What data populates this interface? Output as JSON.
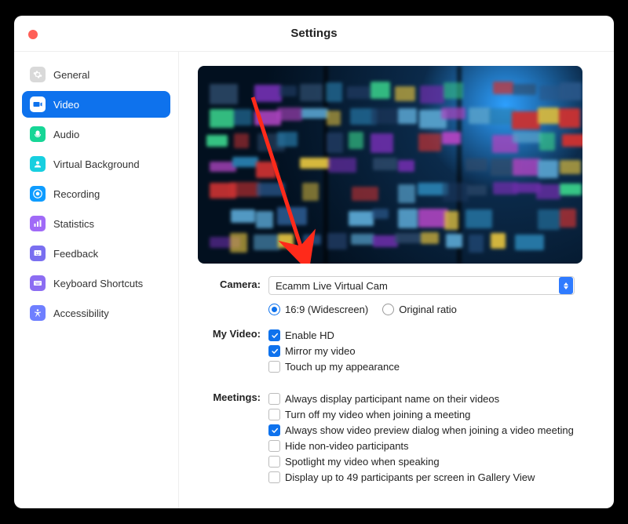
{
  "title": "Settings",
  "sidebar": {
    "items": [
      {
        "label": "General",
        "icon": "gear",
        "color": "#d9d9d9"
      },
      {
        "label": "Video",
        "icon": "video",
        "color": "#0e72ed",
        "active": true
      },
      {
        "label": "Audio",
        "icon": "audio",
        "color": "#16d696"
      },
      {
        "label": "Virtual Background",
        "icon": "virtual-bg",
        "color": "#17cfe0"
      },
      {
        "label": "Recording",
        "icon": "recording",
        "color": "#0e9cff"
      },
      {
        "label": "Statistics",
        "icon": "statistics",
        "color": "#a06af7"
      },
      {
        "label": "Feedback",
        "icon": "feedback",
        "color": "#7a6ff0"
      },
      {
        "label": "Keyboard Shortcuts",
        "icon": "keyboard",
        "color": "#8c6df2"
      },
      {
        "label": "Accessibility",
        "icon": "accessibility",
        "color": "#6f7fff"
      }
    ]
  },
  "camera": {
    "label": "Camera:",
    "selected": "Ecamm Live Virtual Cam",
    "ratio_options": {
      "widescreen": "16:9 (Widescreen)",
      "original": "Original ratio",
      "selected": "widescreen"
    }
  },
  "my_video": {
    "label": "My Video:",
    "options": [
      {
        "label": "Enable HD",
        "checked": true
      },
      {
        "label": "Mirror my video",
        "checked": true
      },
      {
        "label": "Touch up my appearance",
        "checked": false
      }
    ]
  },
  "meetings": {
    "label": "Meetings:",
    "options": [
      {
        "label": "Always display participant name on their videos",
        "checked": false
      },
      {
        "label": "Turn off my video when joining a meeting",
        "checked": false
      },
      {
        "label": "Always show video preview dialog when joining a video meeting",
        "checked": true
      },
      {
        "label": "Hide non-video participants",
        "checked": false
      },
      {
        "label": "Spotlight my video when speaking",
        "checked": false
      },
      {
        "label": "Display up to 49 participants per screen in Gallery View",
        "checked": false
      }
    ]
  }
}
